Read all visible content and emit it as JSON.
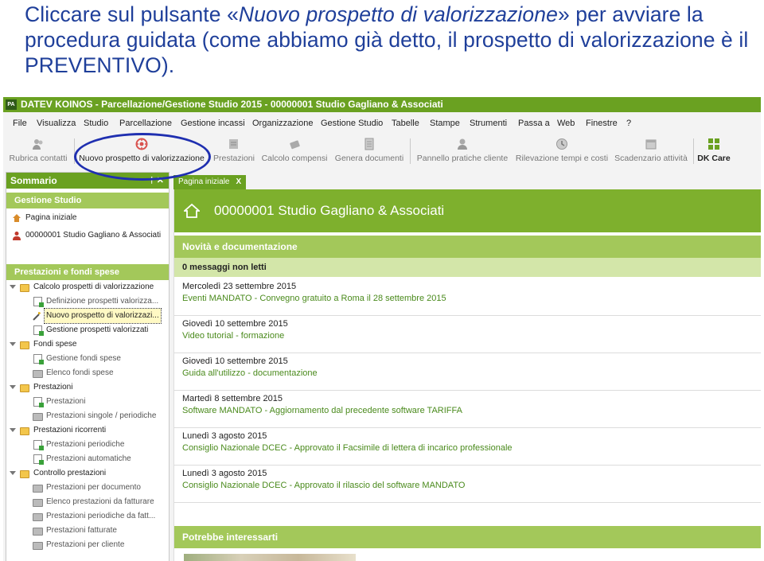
{
  "caption": {
    "part1": "Cliccare sul pulsante «",
    "emph": "Nuovo prospetto di valorizzazione",
    "part2": "» per avviare la procedura guidata (come abbiamo già detto, il prospetto di valorizzazione è il PREVENTIVO)."
  },
  "app": {
    "badge": "PA",
    "title": "DATEV KOINOS - Parcellazione/Gestione Studio 2015  - 00000001 Studio Gagliano & Associati",
    "accent": "#6aa121"
  },
  "menu": [
    "File",
    "Visualizza",
    "Studio",
    "Parcellazione",
    "Gestione incassi",
    "Organizzazione",
    "Gestione Studio",
    "Tabelle",
    "Stampe",
    "Strumenti",
    "Passa a",
    "Web",
    "Finestre",
    "?"
  ],
  "toolbar": [
    {
      "label": "Rubrica contatti",
      "icon": "contacts-icon"
    },
    {
      "label": "Nuovo prospetto di valorizzazione",
      "icon": "new-estimate-icon"
    },
    {
      "label": "Prestazioni",
      "icon": "services-icon"
    },
    {
      "label": "Calcolo compensi",
      "icon": "calculate-icon"
    },
    {
      "label": "Genera documenti",
      "icon": "documents-icon"
    },
    {
      "label": "Pannello pratiche cliente",
      "icon": "client-panel-icon"
    },
    {
      "label": "Rilevazione tempi e costi",
      "icon": "time-tracking-icon"
    },
    {
      "label": "Scadenzario attività",
      "icon": "calendar-icon"
    },
    {
      "label": "DK Care",
      "icon": "dk-care-icon"
    }
  ],
  "sidebar": {
    "title": "Sommario",
    "controls": "† ✕",
    "group1": "Gestione Studio",
    "home": "Pagina iniziale",
    "studio": "00000001 Studio Gagliano & Associati",
    "group2": "Prestazioni e fondi spese",
    "tree": [
      {
        "label": "Calcolo prospetti di valorizzazione",
        "level": 0
      },
      {
        "label": "Definizione prospetti valorizza...",
        "level": 1
      },
      {
        "label": "Nuovo prospetto di valorizzazi...",
        "level": 1,
        "selected": true
      },
      {
        "label": "Gestione prospetti valorizzati",
        "level": 1
      },
      {
        "label": "Fondi spese",
        "level": 0
      },
      {
        "label": "Gestione fondi spese",
        "level": 1
      },
      {
        "label": "Elenco fondi spese",
        "level": 1
      },
      {
        "label": "Prestazioni",
        "level": 0
      },
      {
        "label": "Prestazioni",
        "level": 1
      },
      {
        "label": "Prestazioni singole / periodiche",
        "level": 1
      },
      {
        "label": "Prestazioni ricorrenti",
        "level": 0
      },
      {
        "label": "Prestazioni periodiche",
        "level": 1
      },
      {
        "label": "Prestazioni automatiche",
        "level": 1
      },
      {
        "label": "Controllo prestazioni",
        "level": 0
      },
      {
        "label": "Prestazioni per documento",
        "level": 1
      },
      {
        "label": "Elenco prestazioni da fatturare",
        "level": 1
      },
      {
        "label": "Prestazioni periodiche da fatt...",
        "level": 1
      },
      {
        "label": "Prestazioni fatturate",
        "level": 1
      },
      {
        "label": "Prestazioni per cliente",
        "level": 1
      }
    ]
  },
  "main": {
    "tab": "Pagina iniziale",
    "tab_close": "X",
    "studio_name": "00000001 Studio Gagliano & Associati",
    "news_title": "Novità e documentazione",
    "messages": "0 messaggi non letti",
    "news": [
      {
        "date": "Mercoledì 23 settembre 2015",
        "link": "Eventi MANDATO - Convegno gratuito a Roma il 28 settembre 2015"
      },
      {
        "date": "Giovedì 10 settembre 2015",
        "link": "Video tutorial - formazione"
      },
      {
        "date": "Giovedì 10 settembre 2015",
        "link": "Guida all'utilizzo - documentazione"
      },
      {
        "date": "Martedì 8 settembre 2015",
        "link": "Software MANDATO - Aggiornamento dal precedente software TARIFFA"
      },
      {
        "date": "Lunedì 3 agosto 2015",
        "link": "Consiglio Nazionale DCEC - Approvato il Facsimile di lettera di incarico professionale"
      },
      {
        "date": "Lunedì 3 agosto 2015",
        "link": "Consiglio Nazionale DCEC - Approvato il rilascio del software MANDATO"
      }
    ],
    "interest_title": "Potrebbe interessarti"
  }
}
